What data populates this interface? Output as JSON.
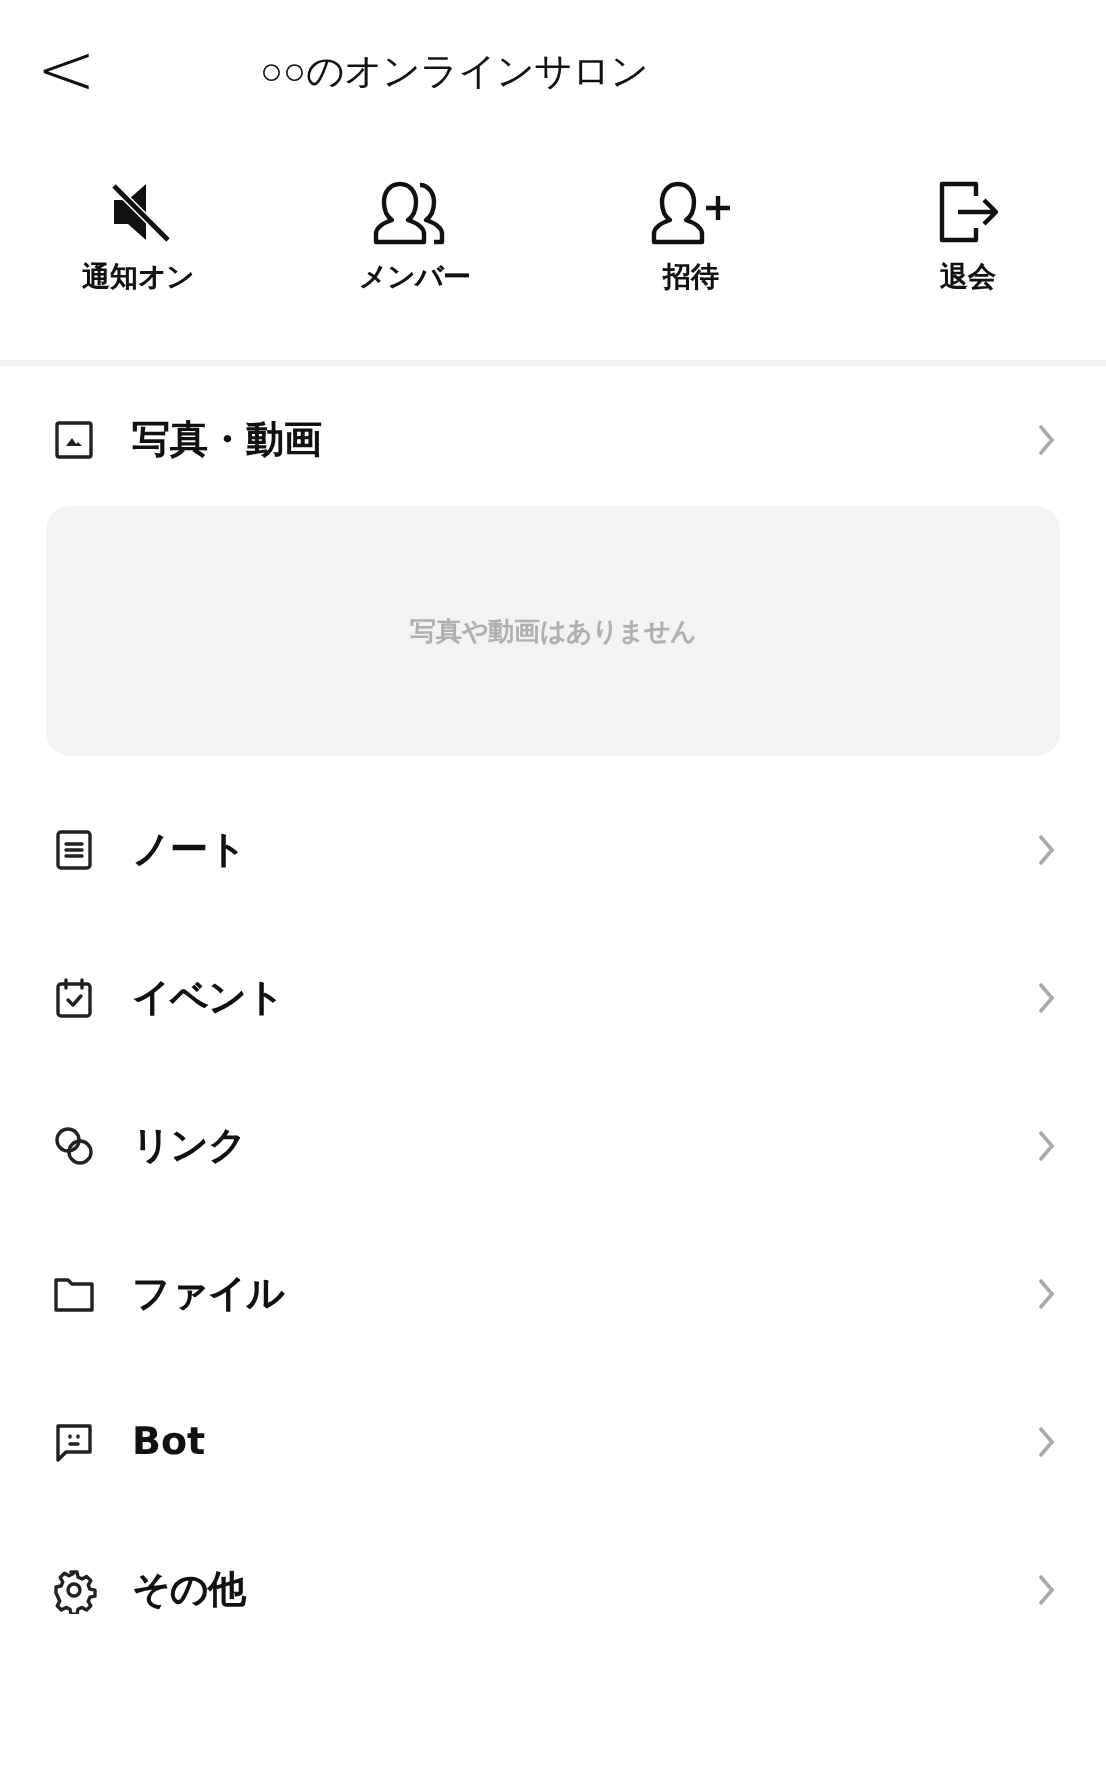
{
  "header": {
    "back": "<",
    "title": "○○のオンラインサロン"
  },
  "actions": [
    {
      "kind": "mute",
      "label": "通知オン"
    },
    {
      "kind": "members",
      "label": "メンバー"
    },
    {
      "kind": "invite",
      "label": "招待"
    },
    {
      "kind": "leave",
      "label": "退会"
    }
  ],
  "media": {
    "label": "写真・動画",
    "empty_text": "写真や動画はありません"
  },
  "menu": [
    {
      "kind": "note",
      "label": "ノート"
    },
    {
      "kind": "event",
      "label": "イベント"
    },
    {
      "kind": "link",
      "label": "リンク"
    },
    {
      "kind": "file",
      "label": "ファイル"
    },
    {
      "kind": "bot",
      "label": "Bot"
    },
    {
      "kind": "other",
      "label": "その他"
    }
  ]
}
